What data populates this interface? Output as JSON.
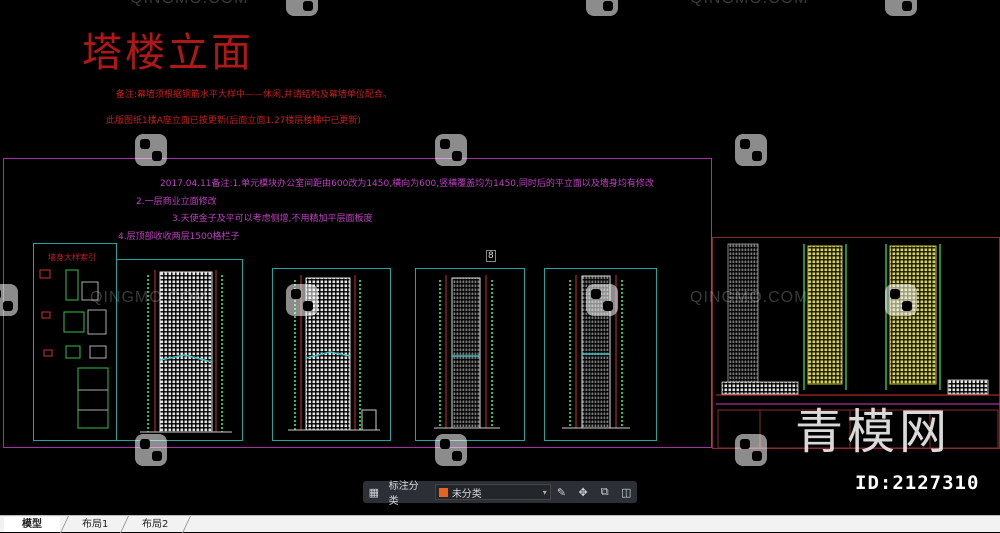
{
  "drawing": {
    "title": "塔楼立面",
    "note_line1": "备注:幕墙须根据钢筋水平大样中——休闲,并请结构及幕墙单位配合。",
    "note_line2": "此版图纸1楼A座立面已按更新(后面立面1.27楼层楼梯中已更新)",
    "revision_lines": [
      "2017.04.11备注:1.单元模块办公室间距由600改为1450,横向为600,竖横覆盖均为1450,同时后的平立面以及墙身均有修改",
      "2.一层商业立面修改",
      "3.天使金子及平可以考虑侧增,不用精加平层面板度",
      "4.层顶部收收两层1500格栏子"
    ],
    "legend_title": "墙身大样索引",
    "marker": "8"
  },
  "watermark": {
    "brand": "QINGMO.COM",
    "big_text": "青模网",
    "id_text": "ID:2127310"
  },
  "toolbar": {
    "grid_icon": "grid-icon",
    "classify_label": "标注分类",
    "select_value": "未分类",
    "select_swatch_color": "#e8641e",
    "icons": [
      "edit-icon",
      "move-icon",
      "copy-icon",
      "layers-icon"
    ]
  },
  "tabs": [
    {
      "label": "模型",
      "active": true
    },
    {
      "label": "布局1",
      "active": false
    },
    {
      "label": "布局2",
      "active": false
    }
  ],
  "colors": {
    "background": "#000000",
    "magenta_frame": "#a62ea6",
    "cyan_frame": "#1fa6a0",
    "title_red": "#b01818"
  }
}
